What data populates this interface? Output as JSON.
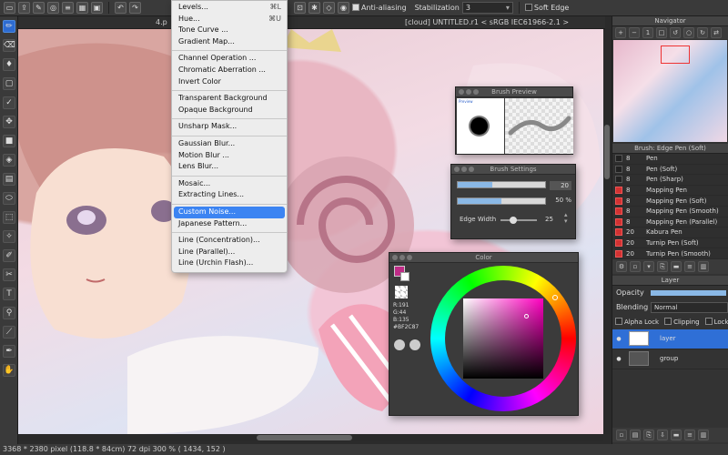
{
  "toolbar": {
    "anti_aliasing_label": "Anti-aliasing",
    "stabilization_label": "Stabilization",
    "stabilization_value": "3",
    "soft_edge_label": "Soft Edge"
  },
  "document": {
    "tab_label": "4.p",
    "title": "[cloud] UNTITLED.r1 < sRGB IEC61966-2.1 >"
  },
  "menu": {
    "items": [
      {
        "label": "Levels...",
        "shortcut": "⌘L"
      },
      {
        "label": "Hue...",
        "shortcut": "⌘U"
      },
      {
        "label": "Tone Curve ..."
      },
      {
        "label": "Gradient Map..."
      },
      {
        "sep": true
      },
      {
        "label": "Channel Operation ..."
      },
      {
        "label": "Chromatic Aberration ..."
      },
      {
        "label": "Invert Color"
      },
      {
        "sep": true
      },
      {
        "label": "Transparent Background"
      },
      {
        "label": "Opaque Background"
      },
      {
        "sep": true
      },
      {
        "label": "Unsharp Mask..."
      },
      {
        "sep": true
      },
      {
        "label": "Gaussian Blur..."
      },
      {
        "label": "Motion Blur ..."
      },
      {
        "label": "Lens Blur..."
      },
      {
        "sep": true
      },
      {
        "label": "Mosaic..."
      },
      {
        "label": "Extracting Lines..."
      },
      {
        "sep": true
      },
      {
        "label": "Custom Noise...",
        "highlighted": true
      },
      {
        "label": "Japanese Pattern..."
      },
      {
        "sep": true
      },
      {
        "label": "Line (Concentration)..."
      },
      {
        "label": "Line (Parallel)..."
      },
      {
        "label": "Line (Urchin Flash)..."
      }
    ]
  },
  "brush_preview": {
    "title": "Brush Preview",
    "tag": "Preview"
  },
  "brush_settings": {
    "title": "Brush Settings",
    "size_value": "20",
    "size_fill": 0.4,
    "opacity_value": "50 %",
    "opacity_fill": 0.5,
    "edge_width_label": "Edge Width",
    "edge_width_value": "25"
  },
  "color": {
    "title": "Color",
    "r": "R:191",
    "g": "G:44",
    "b": "B:135",
    "hex": "#BF2C87",
    "current_color": "#bf2c87"
  },
  "navigator": {
    "title": "Navigator"
  },
  "brush_panel": {
    "title": "Brush: Edge Pen (Soft)",
    "items": [
      {
        "size": "8",
        "name": "Pen",
        "red": false
      },
      {
        "size": "8",
        "name": "Pen (Soft)",
        "red": false
      },
      {
        "size": "8",
        "name": "Pen (Sharp)",
        "red": false
      },
      {
        "size": "8",
        "name": "Mapping Pen",
        "red": true
      },
      {
        "size": "8",
        "name": "Mapping Pen (Soft)",
        "red": true
      },
      {
        "size": "8",
        "name": "Mapping Pen (Smooth)",
        "red": true
      },
      {
        "size": "8",
        "name": "Mapping Pen (Parallel)",
        "red": true
      },
      {
        "size": "20",
        "name": "Kabura Pen",
        "red": true
      },
      {
        "size": "20",
        "name": "Turnip Pen (Soft)",
        "red": true
      },
      {
        "size": "20",
        "name": "Turnip Pen (Smooth)",
        "red": true
      }
    ]
  },
  "layer_panel": {
    "title": "Layer",
    "opacity_label": "Opacity",
    "blending_label": "Blending",
    "blending_value": "Normal",
    "alpha_lock_label": "Alpha Lock",
    "clipping_label": "Clipping",
    "lock_label": "Lock",
    "layers": [
      {
        "name": "layer",
        "selected": true
      },
      {
        "name": "group",
        "selected": false
      }
    ]
  },
  "status": {
    "text": "3368 * 2380 pixel   (118.8 * 84cm)   72 dpi   300 %   ( 1434, 152 )"
  }
}
